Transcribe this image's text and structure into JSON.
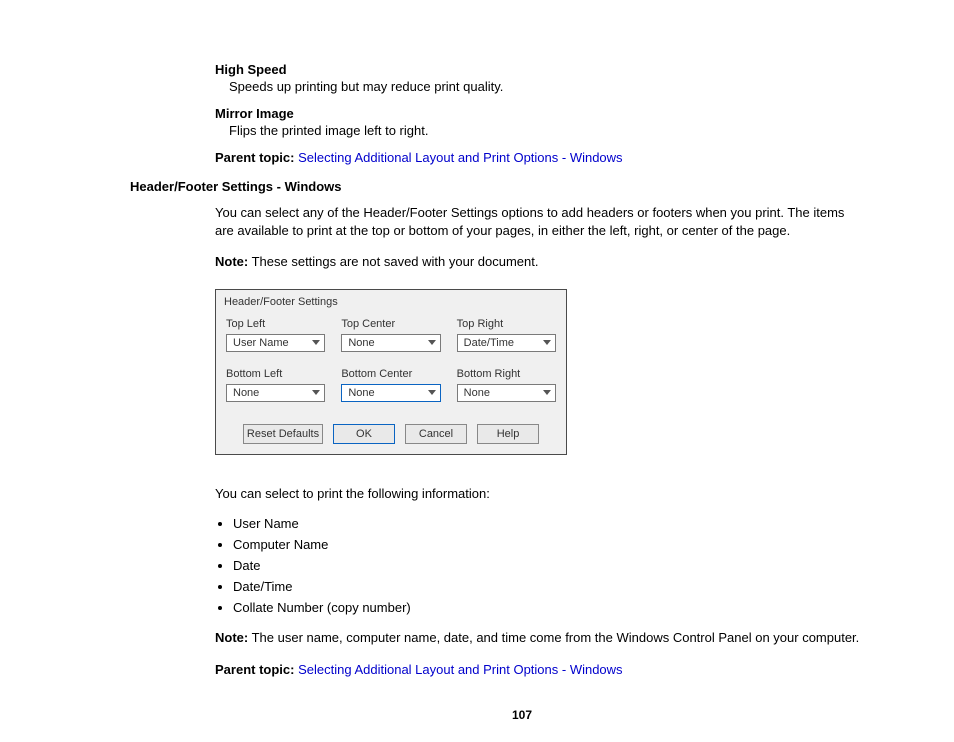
{
  "intro": {
    "term1": "High Speed",
    "def1": "Speeds up printing but may reduce print quality.",
    "term2": "Mirror Image",
    "def2": "Flips the printed image left to right.",
    "parent_label": "Parent topic:",
    "parent_link": "Selecting Additional Layout and Print Options - Windows"
  },
  "section": {
    "heading": "Header/Footer Settings - Windows",
    "para1": "You can select any of the Header/Footer Settings options to add headers or footers when you print. The items are available to print at the top or bottom of your pages, in either the left, right, or center of the page.",
    "note_label": "Note:",
    "note1": " These settings are not saved with your document.",
    "select_intro": "You can select to print the following information:",
    "items": [
      "User Name",
      "Computer Name",
      "Date",
      "Date/Time",
      "Collate Number (copy number)"
    ],
    "note2": " The user name, computer name, date, and time come from the Windows Control Panel on your computer.",
    "parent_label": "Parent topic:",
    "parent_link": "Selecting Additional Layout and Print Options - Windows"
  },
  "dialog": {
    "title": "Header/Footer Settings",
    "labels": {
      "tl": "Top Left",
      "tc": "Top Center",
      "tr": "Top Right",
      "bl": "Bottom Left",
      "bc": "Bottom Center",
      "br": "Bottom Right"
    },
    "values": {
      "tl": "User Name",
      "tc": "None",
      "tr": "Date/Time",
      "bl": "None",
      "bc": "None",
      "br": "None"
    },
    "buttons": {
      "reset": "Reset Defaults",
      "ok": "OK",
      "cancel": "Cancel",
      "help": "Help"
    }
  },
  "page_number": "107"
}
